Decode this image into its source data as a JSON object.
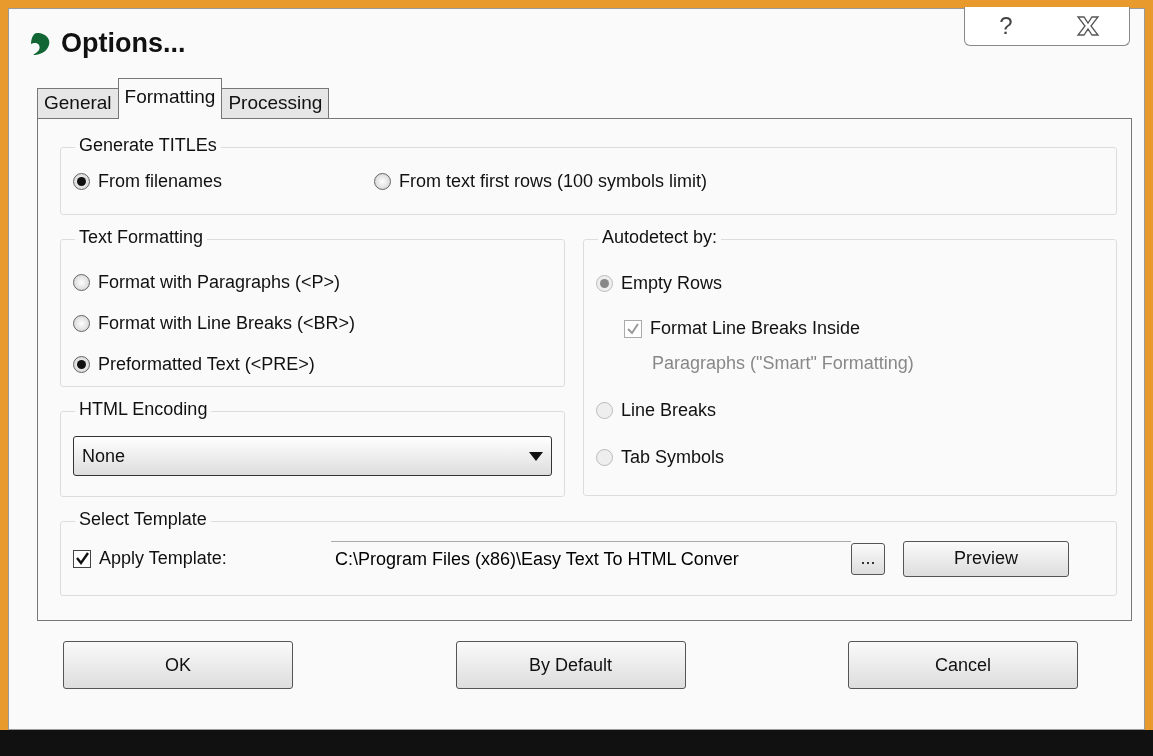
{
  "window": {
    "title": "Options...",
    "help": "?"
  },
  "tabs": [
    {
      "label": "General",
      "selected": false
    },
    {
      "label": "Formatting",
      "selected": true
    },
    {
      "label": "Processing",
      "selected": false
    }
  ],
  "generate_titles": {
    "title": "Generate TITLEs",
    "options": [
      {
        "label": "From filenames",
        "selected": true
      },
      {
        "label": "From text first rows (100 symbols limit)",
        "selected": false
      }
    ]
  },
  "text_formatting": {
    "title": "Text Formatting",
    "options": [
      {
        "label": "Format with Paragraphs (<P>)",
        "selected": false
      },
      {
        "label": "Format with Line Breaks (<BR>)",
        "selected": false
      },
      {
        "label": "Preformatted Text (<PRE>)",
        "selected": true
      }
    ]
  },
  "html_encoding": {
    "title": "HTML Encoding",
    "value": "None"
  },
  "autodetect": {
    "title": "Autodetect by:",
    "options": [
      {
        "kind": "radio",
        "label": "Empty Rows",
        "selected": true,
        "disabled": true
      },
      {
        "kind": "checkbox",
        "label": "Format Line Breaks Inside",
        "label_continued": "Paragraphs (\"Smart\" Formatting)",
        "checked": true,
        "disabled": true
      },
      {
        "kind": "radio",
        "label": "Line Breaks",
        "selected": false,
        "disabled": true
      },
      {
        "kind": "radio",
        "label": "Tab Symbols",
        "selected": false,
        "disabled": true
      }
    ]
  },
  "select_template": {
    "title": "Select Template",
    "apply": {
      "label": "Apply Template:",
      "checked": true
    },
    "path": "C:\\Program Files (x86)\\Easy Text To HTML Conver",
    "browse": "...",
    "preview": "Preview"
  },
  "buttons": [
    "OK",
    "By Default",
    "Cancel"
  ]
}
